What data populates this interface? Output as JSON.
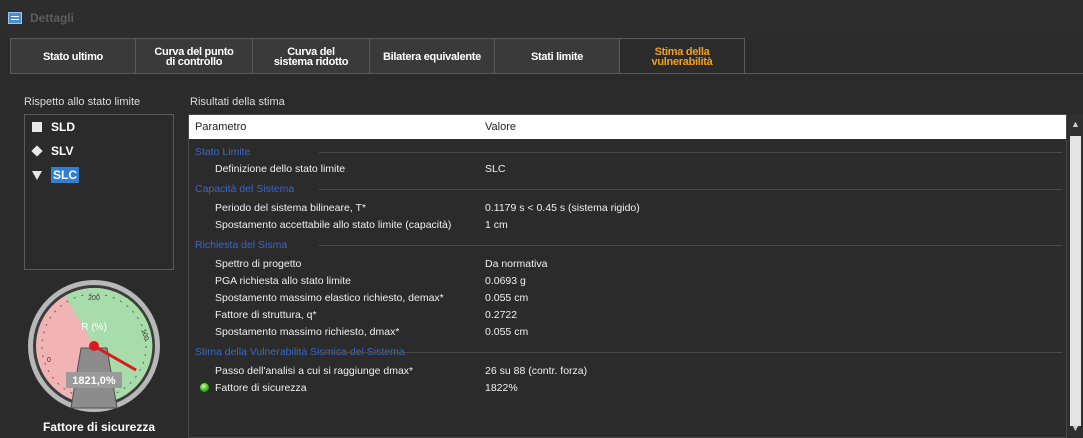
{
  "window": {
    "title": "Dettagli"
  },
  "tabs": [
    {
      "label": "Stato ultimo",
      "active": false
    },
    {
      "label": "Curva del punto di controllo",
      "active": false
    },
    {
      "label": "Curva del sistema ridotto",
      "active": false
    },
    {
      "label": "Bilatera equivalente",
      "active": false
    },
    {
      "label": "Stati limite",
      "active": false
    },
    {
      "label": "Stima della vulnerabilità",
      "active": true
    }
  ],
  "left_panel": {
    "label": "Rispetto allo stato limite",
    "items": [
      {
        "label": "SLD",
        "symbol": "square"
      },
      {
        "label": "SLV",
        "symbol": "diamond"
      },
      {
        "label": "SLC",
        "symbol": "triangle",
        "selected": true
      }
    ],
    "gauge": {
      "axis_label": "R (%)",
      "value_text": "1821,0%",
      "tick_200": "200",
      "tick_100": "100",
      "tick_0": "0",
      "caption": "Fattore di sicurezza"
    }
  },
  "results": {
    "label": "Risultati della stima",
    "columns": [
      "Parametro",
      "Valore"
    ],
    "groups": [
      {
        "title": "Stato Limite",
        "rows": [
          {
            "param": "Definizione dello stato limite",
            "value": "SLC"
          }
        ]
      },
      {
        "title": "Capacità del Sistema",
        "rows": [
          {
            "param": "Periodo del sistema bilineare, T*",
            "value": "0.1179 s < 0.45 s (sistema rigido)"
          },
          {
            "param": "Spostamento accettabile allo stato limite (capacità)",
            "value": "1 cm"
          }
        ]
      },
      {
        "title": "Richiesta del Sisma",
        "rows": [
          {
            "param": "Spettro di progetto",
            "value": "Da normativa"
          },
          {
            "param": "PGA richiesta allo stato limite",
            "value": "0.0693 g"
          },
          {
            "param": "Spostamento massimo elastico richiesto, demax*",
            "value": "0.055 cm"
          },
          {
            "param": "Fattore di struttura, q*",
            "value": "0.2722"
          },
          {
            "param": "Spostamento massimo richiesto, dmax*",
            "value": "0.055 cm"
          }
        ]
      },
      {
        "title": "Stima della Vulnerabilità Sismica del Sistema",
        "rows": [
          {
            "param": "Passo dell'analisi a cui si raggiunge dmax*",
            "value": "26 su 88 (contr. forza)"
          },
          {
            "param": "Fattore di sicurezza",
            "value": "1822%",
            "status_icon": "green-status-icon"
          }
        ]
      }
    ]
  },
  "colors": {
    "accent": "#f0a020",
    "selection": "#2f7fd4",
    "group_title": "#3a66c8"
  }
}
